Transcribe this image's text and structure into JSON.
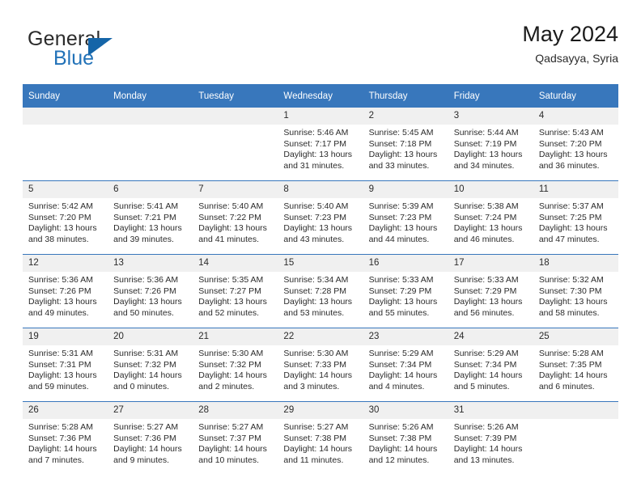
{
  "brand": {
    "name_top": "General",
    "name_bottom": "Blue",
    "accent_color": "#1565a8",
    "blue_text_color": "#2272b8"
  },
  "header": {
    "title": "May 2024",
    "subtitle": "Qadsayya, Syria"
  },
  "theme": {
    "header_row_bg": "#3877bc",
    "daynum_bg": "#f0f0f0",
    "grid_line": "#3877bc"
  },
  "weekdays": [
    "Sunday",
    "Monday",
    "Tuesday",
    "Wednesday",
    "Thursday",
    "Friday",
    "Saturday"
  ],
  "weeks": [
    [
      {
        "day": "",
        "empty": true
      },
      {
        "day": "",
        "empty": true
      },
      {
        "day": "",
        "empty": true
      },
      {
        "day": "1",
        "sunrise": "Sunrise: 5:46 AM",
        "sunset": "Sunset: 7:17 PM",
        "daylight1": "Daylight: 13 hours",
        "daylight2": "and 31 minutes."
      },
      {
        "day": "2",
        "sunrise": "Sunrise: 5:45 AM",
        "sunset": "Sunset: 7:18 PM",
        "daylight1": "Daylight: 13 hours",
        "daylight2": "and 33 minutes."
      },
      {
        "day": "3",
        "sunrise": "Sunrise: 5:44 AM",
        "sunset": "Sunset: 7:19 PM",
        "daylight1": "Daylight: 13 hours",
        "daylight2": "and 34 minutes."
      },
      {
        "day": "4",
        "sunrise": "Sunrise: 5:43 AM",
        "sunset": "Sunset: 7:20 PM",
        "daylight1": "Daylight: 13 hours",
        "daylight2": "and 36 minutes."
      }
    ],
    [
      {
        "day": "5",
        "sunrise": "Sunrise: 5:42 AM",
        "sunset": "Sunset: 7:20 PM",
        "daylight1": "Daylight: 13 hours",
        "daylight2": "and 38 minutes."
      },
      {
        "day": "6",
        "sunrise": "Sunrise: 5:41 AM",
        "sunset": "Sunset: 7:21 PM",
        "daylight1": "Daylight: 13 hours",
        "daylight2": "and 39 minutes."
      },
      {
        "day": "7",
        "sunrise": "Sunrise: 5:40 AM",
        "sunset": "Sunset: 7:22 PM",
        "daylight1": "Daylight: 13 hours",
        "daylight2": "and 41 minutes."
      },
      {
        "day": "8",
        "sunrise": "Sunrise: 5:40 AM",
        "sunset": "Sunset: 7:23 PM",
        "daylight1": "Daylight: 13 hours",
        "daylight2": "and 43 minutes."
      },
      {
        "day": "9",
        "sunrise": "Sunrise: 5:39 AM",
        "sunset": "Sunset: 7:23 PM",
        "daylight1": "Daylight: 13 hours",
        "daylight2": "and 44 minutes."
      },
      {
        "day": "10",
        "sunrise": "Sunrise: 5:38 AM",
        "sunset": "Sunset: 7:24 PM",
        "daylight1": "Daylight: 13 hours",
        "daylight2": "and 46 minutes."
      },
      {
        "day": "11",
        "sunrise": "Sunrise: 5:37 AM",
        "sunset": "Sunset: 7:25 PM",
        "daylight1": "Daylight: 13 hours",
        "daylight2": "and 47 minutes."
      }
    ],
    [
      {
        "day": "12",
        "sunrise": "Sunrise: 5:36 AM",
        "sunset": "Sunset: 7:26 PM",
        "daylight1": "Daylight: 13 hours",
        "daylight2": "and 49 minutes."
      },
      {
        "day": "13",
        "sunrise": "Sunrise: 5:36 AM",
        "sunset": "Sunset: 7:26 PM",
        "daylight1": "Daylight: 13 hours",
        "daylight2": "and 50 minutes."
      },
      {
        "day": "14",
        "sunrise": "Sunrise: 5:35 AM",
        "sunset": "Sunset: 7:27 PM",
        "daylight1": "Daylight: 13 hours",
        "daylight2": "and 52 minutes."
      },
      {
        "day": "15",
        "sunrise": "Sunrise: 5:34 AM",
        "sunset": "Sunset: 7:28 PM",
        "daylight1": "Daylight: 13 hours",
        "daylight2": "and 53 minutes."
      },
      {
        "day": "16",
        "sunrise": "Sunrise: 5:33 AM",
        "sunset": "Sunset: 7:29 PM",
        "daylight1": "Daylight: 13 hours",
        "daylight2": "and 55 minutes."
      },
      {
        "day": "17",
        "sunrise": "Sunrise: 5:33 AM",
        "sunset": "Sunset: 7:29 PM",
        "daylight1": "Daylight: 13 hours",
        "daylight2": "and 56 minutes."
      },
      {
        "day": "18",
        "sunrise": "Sunrise: 5:32 AM",
        "sunset": "Sunset: 7:30 PM",
        "daylight1": "Daylight: 13 hours",
        "daylight2": "and 58 minutes."
      }
    ],
    [
      {
        "day": "19",
        "sunrise": "Sunrise: 5:31 AM",
        "sunset": "Sunset: 7:31 PM",
        "daylight1": "Daylight: 13 hours",
        "daylight2": "and 59 minutes."
      },
      {
        "day": "20",
        "sunrise": "Sunrise: 5:31 AM",
        "sunset": "Sunset: 7:32 PM",
        "daylight1": "Daylight: 14 hours",
        "daylight2": "and 0 minutes."
      },
      {
        "day": "21",
        "sunrise": "Sunrise: 5:30 AM",
        "sunset": "Sunset: 7:32 PM",
        "daylight1": "Daylight: 14 hours",
        "daylight2": "and 2 minutes."
      },
      {
        "day": "22",
        "sunrise": "Sunrise: 5:30 AM",
        "sunset": "Sunset: 7:33 PM",
        "daylight1": "Daylight: 14 hours",
        "daylight2": "and 3 minutes."
      },
      {
        "day": "23",
        "sunrise": "Sunrise: 5:29 AM",
        "sunset": "Sunset: 7:34 PM",
        "daylight1": "Daylight: 14 hours",
        "daylight2": "and 4 minutes."
      },
      {
        "day": "24",
        "sunrise": "Sunrise: 5:29 AM",
        "sunset": "Sunset: 7:34 PM",
        "daylight1": "Daylight: 14 hours",
        "daylight2": "and 5 minutes."
      },
      {
        "day": "25",
        "sunrise": "Sunrise: 5:28 AM",
        "sunset": "Sunset: 7:35 PM",
        "daylight1": "Daylight: 14 hours",
        "daylight2": "and 6 minutes."
      }
    ],
    [
      {
        "day": "26",
        "sunrise": "Sunrise: 5:28 AM",
        "sunset": "Sunset: 7:36 PM",
        "daylight1": "Daylight: 14 hours",
        "daylight2": "and 7 minutes."
      },
      {
        "day": "27",
        "sunrise": "Sunrise: 5:27 AM",
        "sunset": "Sunset: 7:36 PM",
        "daylight1": "Daylight: 14 hours",
        "daylight2": "and 9 minutes."
      },
      {
        "day": "28",
        "sunrise": "Sunrise: 5:27 AM",
        "sunset": "Sunset: 7:37 PM",
        "daylight1": "Daylight: 14 hours",
        "daylight2": "and 10 minutes."
      },
      {
        "day": "29",
        "sunrise": "Sunrise: 5:27 AM",
        "sunset": "Sunset: 7:38 PM",
        "daylight1": "Daylight: 14 hours",
        "daylight2": "and 11 minutes."
      },
      {
        "day": "30",
        "sunrise": "Sunrise: 5:26 AM",
        "sunset": "Sunset: 7:38 PM",
        "daylight1": "Daylight: 14 hours",
        "daylight2": "and 12 minutes."
      },
      {
        "day": "31",
        "sunrise": "Sunrise: 5:26 AM",
        "sunset": "Sunset: 7:39 PM",
        "daylight1": "Daylight: 14 hours",
        "daylight2": "and 13 minutes."
      },
      {
        "day": "",
        "empty": true
      }
    ]
  ]
}
